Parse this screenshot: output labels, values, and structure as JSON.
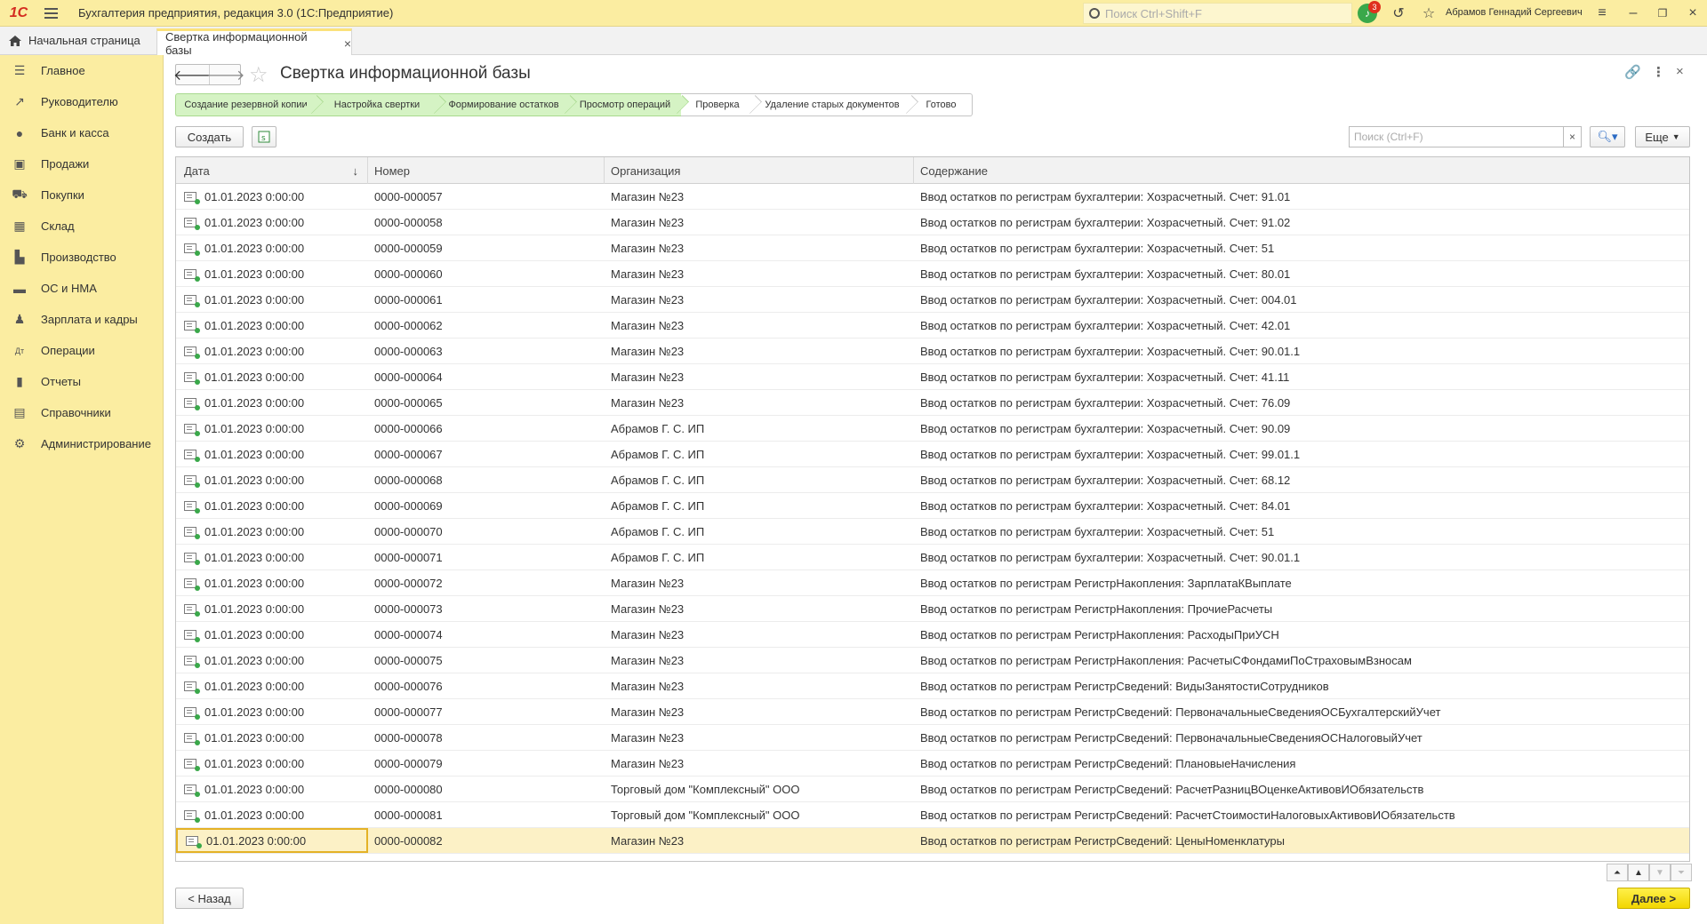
{
  "app": {
    "logo": "1С",
    "title": "Бухгалтерия предприятия, редакция 3.0  (1С:Предприятие)",
    "search_placeholder": "Поиск Ctrl+Shift+F",
    "notifications_count": "3",
    "user": "Абрамов Геннадий Сергеевич"
  },
  "tabs": {
    "home": "Начальная страница",
    "active": "Свертка информационной базы",
    "close": "×"
  },
  "sidebar": {
    "items": [
      {
        "label": "Главное",
        "icon": "menu-icon"
      },
      {
        "label": "Руководителю",
        "icon": "trend-icon"
      },
      {
        "label": "Банк и касса",
        "icon": "coins-icon"
      },
      {
        "label": "Продажи",
        "icon": "bag-icon"
      },
      {
        "label": "Покупки",
        "icon": "cart-icon"
      },
      {
        "label": "Склад",
        "icon": "boxes-icon"
      },
      {
        "label": "Производство",
        "icon": "factory-icon"
      },
      {
        "label": "ОС и НМА",
        "icon": "truck-icon"
      },
      {
        "label": "Зарплата и кадры",
        "icon": "person-icon"
      },
      {
        "label": "Операции",
        "icon": "dt-kt-icon"
      },
      {
        "label": "Отчеты",
        "icon": "bar-chart-icon"
      },
      {
        "label": "Справочники",
        "icon": "books-icon"
      },
      {
        "label": "Администрирование",
        "icon": "gear-icon"
      }
    ]
  },
  "page": {
    "title": "Свертка информационной базы",
    "steps": [
      {
        "label": "Создание резервной копии",
        "done": true
      },
      {
        "label": "Настройка свертки",
        "done": true
      },
      {
        "label": "Формирование остатков",
        "done": true
      },
      {
        "label": "Просмотр операций",
        "done": true
      },
      {
        "label": "Проверка",
        "done": false
      },
      {
        "label": "Удаление старых документов",
        "done": false
      },
      {
        "label": "Готово",
        "done": false
      }
    ],
    "create_button": "Создать",
    "search_placeholder": "Поиск (Ctrl+F)",
    "search_clear": "×",
    "more_button": "Еще",
    "back_button": "< Назад",
    "next_button": "Далее >"
  },
  "table": {
    "columns": [
      "Дата",
      "Номер",
      "Организация",
      "Содержание"
    ],
    "sort_indicator": "↓",
    "selected_row": 25,
    "rows": [
      [
        "01.01.2023 0:00:00",
        "0000-000057",
        "Магазин №23",
        "Ввод остатков по регистрам бухгалтерии: Хозрасчетный. Счет: 91.01"
      ],
      [
        "01.01.2023 0:00:00",
        "0000-000058",
        "Магазин №23",
        "Ввод остатков по регистрам бухгалтерии: Хозрасчетный. Счет: 91.02"
      ],
      [
        "01.01.2023 0:00:00",
        "0000-000059",
        "Магазин №23",
        "Ввод остатков по регистрам бухгалтерии: Хозрасчетный. Счет: 51"
      ],
      [
        "01.01.2023 0:00:00",
        "0000-000060",
        "Магазин №23",
        "Ввод остатков по регистрам бухгалтерии: Хозрасчетный. Счет: 80.01"
      ],
      [
        "01.01.2023 0:00:00",
        "0000-000061",
        "Магазин №23",
        "Ввод остатков по регистрам бухгалтерии: Хозрасчетный. Счет: 004.01"
      ],
      [
        "01.01.2023 0:00:00",
        "0000-000062",
        "Магазин №23",
        "Ввод остатков по регистрам бухгалтерии: Хозрасчетный. Счет: 42.01"
      ],
      [
        "01.01.2023 0:00:00",
        "0000-000063",
        "Магазин №23",
        "Ввод остатков по регистрам бухгалтерии: Хозрасчетный. Счет: 90.01.1"
      ],
      [
        "01.01.2023 0:00:00",
        "0000-000064",
        "Магазин №23",
        "Ввод остатков по регистрам бухгалтерии: Хозрасчетный. Счет: 41.11"
      ],
      [
        "01.01.2023 0:00:00",
        "0000-000065",
        "Магазин №23",
        "Ввод остатков по регистрам бухгалтерии: Хозрасчетный. Счет: 76.09"
      ],
      [
        "01.01.2023 0:00:00",
        "0000-000066",
        "Абрамов Г. С. ИП",
        "Ввод остатков по регистрам бухгалтерии: Хозрасчетный. Счет: 90.09"
      ],
      [
        "01.01.2023 0:00:00",
        "0000-000067",
        "Абрамов Г. С. ИП",
        "Ввод остатков по регистрам бухгалтерии: Хозрасчетный. Счет: 99.01.1"
      ],
      [
        "01.01.2023 0:00:00",
        "0000-000068",
        "Абрамов Г. С. ИП",
        "Ввод остатков по регистрам бухгалтерии: Хозрасчетный. Счет: 68.12"
      ],
      [
        "01.01.2023 0:00:00",
        "0000-000069",
        "Абрамов Г. С. ИП",
        "Ввод остатков по регистрам бухгалтерии: Хозрасчетный. Счет: 84.01"
      ],
      [
        "01.01.2023 0:00:00",
        "0000-000070",
        "Абрамов Г. С. ИП",
        "Ввод остатков по регистрам бухгалтерии: Хозрасчетный. Счет: 51"
      ],
      [
        "01.01.2023 0:00:00",
        "0000-000071",
        "Абрамов Г. С. ИП",
        "Ввод остатков по регистрам бухгалтерии: Хозрасчетный. Счет: 90.01.1"
      ],
      [
        "01.01.2023 0:00:00",
        "0000-000072",
        "Магазин №23",
        "Ввод остатков по регистрам РегистрНакопления: ЗарплатаКВыплате"
      ],
      [
        "01.01.2023 0:00:00",
        "0000-000073",
        "Магазин №23",
        "Ввод остатков по регистрам РегистрНакопления: ПрочиеРасчеты"
      ],
      [
        "01.01.2023 0:00:00",
        "0000-000074",
        "Магазин №23",
        "Ввод остатков по регистрам РегистрНакопления: РасходыПриУСН"
      ],
      [
        "01.01.2023 0:00:00",
        "0000-000075",
        "Магазин №23",
        "Ввод остатков по регистрам РегистрНакопления: РасчетыСФондамиПоСтраховымВзносам"
      ],
      [
        "01.01.2023 0:00:00",
        "0000-000076",
        "Магазин №23",
        "Ввод остатков по регистрам РегистрСведений: ВидыЗанятостиСотрудников"
      ],
      [
        "01.01.2023 0:00:00",
        "0000-000077",
        "Магазин №23",
        "Ввод остатков по регистрам РегистрСведений: ПервоначальныеСведенияОСБухгалтерскийУчет"
      ],
      [
        "01.01.2023 0:00:00",
        "0000-000078",
        "Магазин №23",
        "Ввод остатков по регистрам РегистрСведений: ПервоначальныеСведенияОСНалоговыйУчет"
      ],
      [
        "01.01.2023 0:00:00",
        "0000-000079",
        "Магазин №23",
        "Ввод остатков по регистрам РегистрСведений: ПлановыеНачисления"
      ],
      [
        "01.01.2023 0:00:00",
        "0000-000080",
        "Торговый дом \"Комплексный\" ООО",
        "Ввод остатков по регистрам РегистрСведений: РасчетРазницВОценкеАктивовИОбязательств"
      ],
      [
        "01.01.2023 0:00:00",
        "0000-000081",
        "Торговый дом \"Комплексный\" ООО",
        "Ввод остатков по регистрам РегистрСведений: РасчетСтоимостиНалоговыхАктивовИОбязательств"
      ],
      [
        "01.01.2023 0:00:00",
        "0000-000082",
        "Магазин №23",
        "Ввод остатков по регистрам РегистрСведений: ЦеныНоменклатуры"
      ]
    ]
  }
}
